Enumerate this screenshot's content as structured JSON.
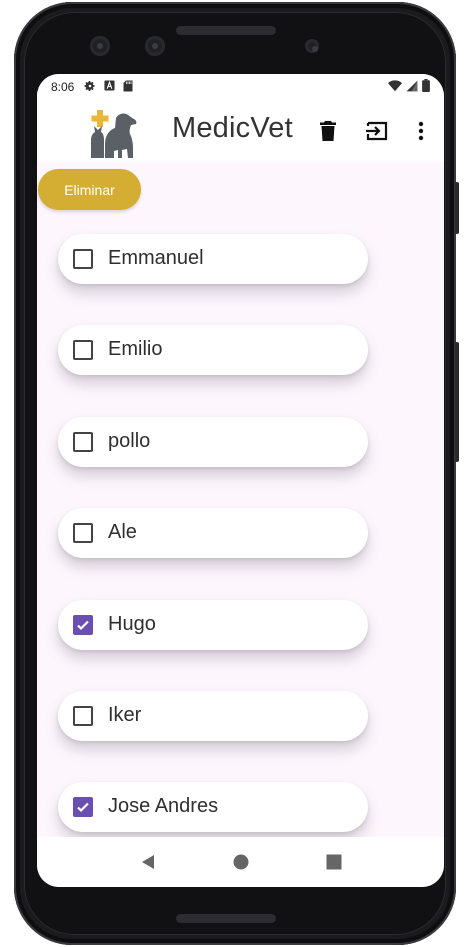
{
  "status_bar": {
    "time": "8:06",
    "left_icons": [
      "settings-icon",
      "text-a-icon",
      "sd-card-icon"
    ],
    "right_icons": [
      "wifi-icon",
      "signal-icon",
      "battery-icon"
    ]
  },
  "app_bar": {
    "title": "MedicVet",
    "logo_icon": "vet-logo-icon",
    "actions": [
      "trash-icon",
      "logout-icon",
      "more-vert-icon"
    ]
  },
  "delete_button": {
    "label": "Eliminar"
  },
  "pets": [
    {
      "name": "Emmanuel",
      "checked": false
    },
    {
      "name": "Emilio",
      "checked": false
    },
    {
      "name": "pollo",
      "checked": false
    },
    {
      "name": "Ale",
      "checked": false
    },
    {
      "name": "Hugo",
      "checked": true
    },
    {
      "name": "Iker",
      "checked": false
    },
    {
      "name": "Jose Andres",
      "checked": true
    }
  ],
  "nav_bar": {
    "buttons": [
      "back-icon",
      "home-icon",
      "recents-icon"
    ]
  },
  "colors": {
    "accent": "#d4ae33",
    "checkbox_checked": "#6a4fb0",
    "screen_bg": "#fdf7fd"
  }
}
